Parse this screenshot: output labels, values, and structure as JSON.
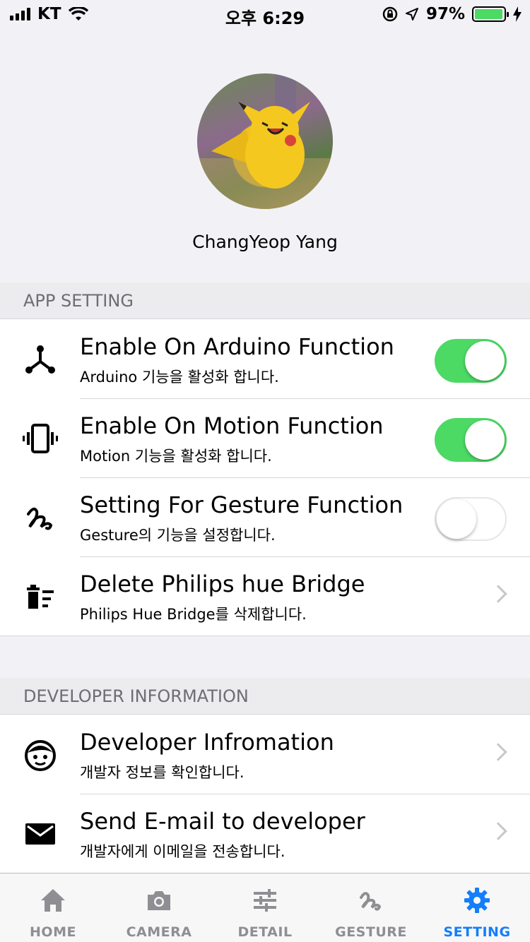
{
  "status_bar": {
    "carrier": "KT",
    "time": "오후 6:29",
    "battery_percent": "97%",
    "battery_level": 0.97,
    "battery_color": "#4cd964"
  },
  "profile": {
    "name": "ChangYeop Yang"
  },
  "sections": {
    "app_setting": "APP SETTING",
    "developer_information": "DEVELOPER INFORMATION"
  },
  "app_rows": [
    {
      "icon": "arduino-icon",
      "title": "Enable On Arduino Function",
      "subtitle": "Arduino 기능을 활성화 합니다.",
      "toggle": true
    },
    {
      "icon": "vibration-icon",
      "title": "Enable On Motion Function",
      "subtitle": "Motion 기능을 활성화 합니다.",
      "toggle": true
    },
    {
      "icon": "gesture-icon",
      "title": "Setting For Gesture Function",
      "subtitle": "Gesture의 기능을 설정합니다.",
      "toggle": false
    },
    {
      "icon": "delete-sweep-icon",
      "title": "Delete Philips hue Bridge",
      "subtitle": "Philips Hue Bridge를 삭제합니다."
    }
  ],
  "dev_rows": [
    {
      "icon": "face-icon",
      "title": "Developer Infromation",
      "subtitle": "개발자 정보를 확인합니다."
    },
    {
      "icon": "mail-icon",
      "title": "Send E-mail to developer",
      "subtitle": "개발자에게 이메일을 전송합니다."
    }
  ],
  "tabs": [
    {
      "label": "HOME",
      "icon": "home-icon"
    },
    {
      "label": "CAMERA",
      "icon": "camera-icon"
    },
    {
      "label": "DETAIL",
      "icon": "sliders-icon"
    },
    {
      "label": "GESTURE",
      "icon": "gesture-icon"
    },
    {
      "label": "SETTING",
      "icon": "gear-icon",
      "active": true
    }
  ],
  "colors": {
    "accent": "#147efb",
    "toggle_on": "#4cd964",
    "inactive_tab": "#8e8e93"
  }
}
